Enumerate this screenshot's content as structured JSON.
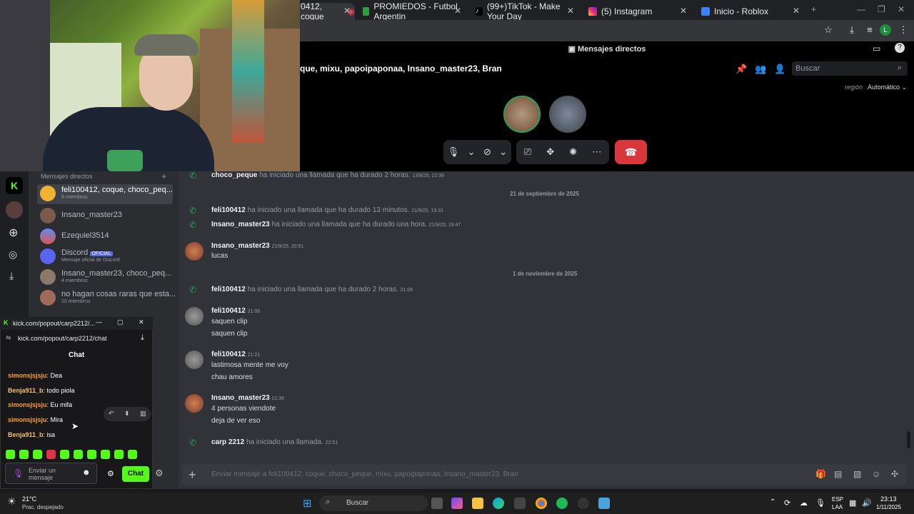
{
  "browser": {
    "tabs": [
      {
        "label": "0412, coque",
        "icon": "discord-icon"
      },
      {
        "label": "PROMIEDOS - Futbol Argentin",
        "icon": "promiedos-icon"
      },
      {
        "label": "(99+)TikTok - Make Your Day",
        "icon": "tiktok-icon"
      },
      {
        "label": "(5) Instagram",
        "icon": "instagram-icon"
      },
      {
        "label": "Inicio - Roblox",
        "icon": "roblox-icon"
      }
    ],
    "profile_initial": "L"
  },
  "discord": {
    "title": "Mensajes directos",
    "group_name": "que, mixu, papoipaponaa, Insano_master23, Bran",
    "search_placeholder": "Buscar",
    "region_label": "región",
    "region_value": "Automático",
    "dm_header": "Mensajes directos",
    "dms": [
      {
        "name": "feli100412, coque, choco_peq...",
        "sub": "8 miembros"
      },
      {
        "name": "Insano_master23",
        "sub": ""
      },
      {
        "name": "Ezequiel3514",
        "sub": ""
      },
      {
        "name": "Discord",
        "badge": "OFICIAL",
        "sub": "Mensaje oficial de Discord"
      },
      {
        "name": "Insano_master23, choco_peq...",
        "sub": "4 miembros"
      },
      {
        "name": "no hagan cosas raras que esta...",
        "sub": "10 miembros"
      }
    ],
    "messages": {
      "m1": {
        "user": "choco_peque",
        "text": "ha iniciado una llamada que ha durado 2 horas.",
        "time": "13/8/25, 22:39"
      },
      "d1": "21 de septiembre de 2025",
      "m2": {
        "user": "feli100412",
        "text": "ha iniciado una llamada que ha durado 13 minutos.",
        "time": "21/9/25, 19:31"
      },
      "m3": {
        "user": "Insano_master23",
        "text": "ha iniciado una llamada que ha durado una hora.",
        "time": "21/9/25, 19:47"
      },
      "m4": {
        "user": "Insano_master23",
        "time": "21/9/25, 20:51",
        "lines": [
          "lucas"
        ]
      },
      "d2": "1 de noviembre de 2025",
      "m5": {
        "user": "feli100412",
        "text": "ha iniciado una llamada que ha durado 2 horas.",
        "time": "21:06"
      },
      "m6": {
        "user": "feli100412",
        "time": "21:08",
        "lines": [
          "saquen clip",
          "saquen clip"
        ]
      },
      "m7": {
        "user": "feli100412",
        "time": "21:21",
        "lines": [
          "lastimosa mente me voy",
          "chau amores"
        ]
      },
      "m8": {
        "user": "Insano_master23",
        "time": "21:36",
        "lines": [
          "4 personas viendote",
          "deja de ver eso"
        ]
      },
      "m9": {
        "user": "carp 2212",
        "text": "ha iniciado una llamada.",
        "time": "22:51"
      }
    },
    "input_placeholder": "Enviar mensaje a feli100412, coque, choco_peque, mixu, papoipaponaa, Insano_master23, Bran"
  },
  "kick": {
    "window_title": "kick.com/popout/carp2212/...",
    "url": "kick.com/popout/carp2212/chat",
    "chat_header": "Chat",
    "messages": [
      {
        "user": "simonsjsjsju",
        "text": ": Dea"
      },
      {
        "user": "Benja911_b",
        "text": ": todo piola"
      },
      {
        "user": "simonsjsjsju",
        "text": ": Eu mifa"
      },
      {
        "user": "simonsjsjsju",
        "text": ": Mira"
      },
      {
        "user": "Benja911_b",
        "text": ": isa"
      }
    ],
    "input_placeholder": "Enviar un mensaje",
    "chat_button": "Chat"
  },
  "taskbar": {
    "weather_temp": "21°C",
    "weather_desc": "Prac. despejado",
    "search_label": "Buscar",
    "lang1": "ESP",
    "lang2": "LAA",
    "time": "23:13",
    "date": "1/11/2025"
  },
  "colors": {
    "accent_green": "#53fc18",
    "discord_red": "#da373c",
    "call_green": "#23a55a"
  }
}
